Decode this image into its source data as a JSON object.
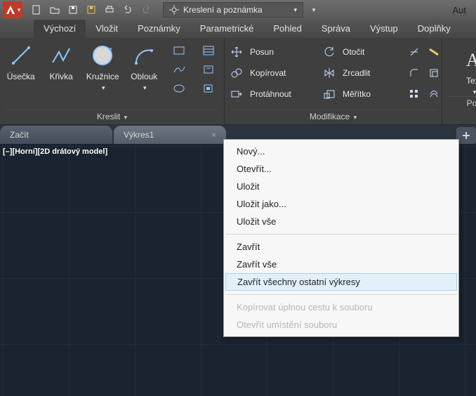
{
  "title": "Aut",
  "workspace": {
    "label": "Kreslení a poznámka"
  },
  "ribbon_tabs": [
    "Výchozí",
    "Vložit",
    "Poznámky",
    "Parametrické",
    "Pohled",
    "Správa",
    "Výstup",
    "Doplňky"
  ],
  "panels": {
    "draw": {
      "title": "Kreslit",
      "tools": {
        "line": "Úsečka",
        "curve": "Křivka",
        "circle": "Kružnice",
        "arc": "Oblouk"
      }
    },
    "modify": {
      "title": "Modifikace",
      "posun": "Posun",
      "otocit": "Otočit",
      "kopirovat": "Kopírovat",
      "zrcadlit": "Zrcadlit",
      "protahnout": "Protáhnout",
      "meritko": "Měřítko"
    },
    "annot": {
      "title": "Poz",
      "text": "Text"
    }
  },
  "doc_tabs": [
    "Začít",
    "Výkres1"
  ],
  "viewport_label": "[–][Horní][2D drátový model]",
  "context_menu": {
    "novy": "Nový...",
    "otevrit": "Otevřít...",
    "ulozit": "Uložit",
    "ulozit_jako": "Uložit jako...",
    "ulozit_vse": "Uložit vše",
    "zavrit": "Zavřít",
    "zavrit_vse": "Zavřít vše",
    "zavrit_ostatni": "Zavřít všechny ostatní výkresy",
    "kopirovat_cestu": "Kopírovat úplnou cestu k souboru",
    "otevrit_umisteni": "Otevřít umístění souboru"
  }
}
